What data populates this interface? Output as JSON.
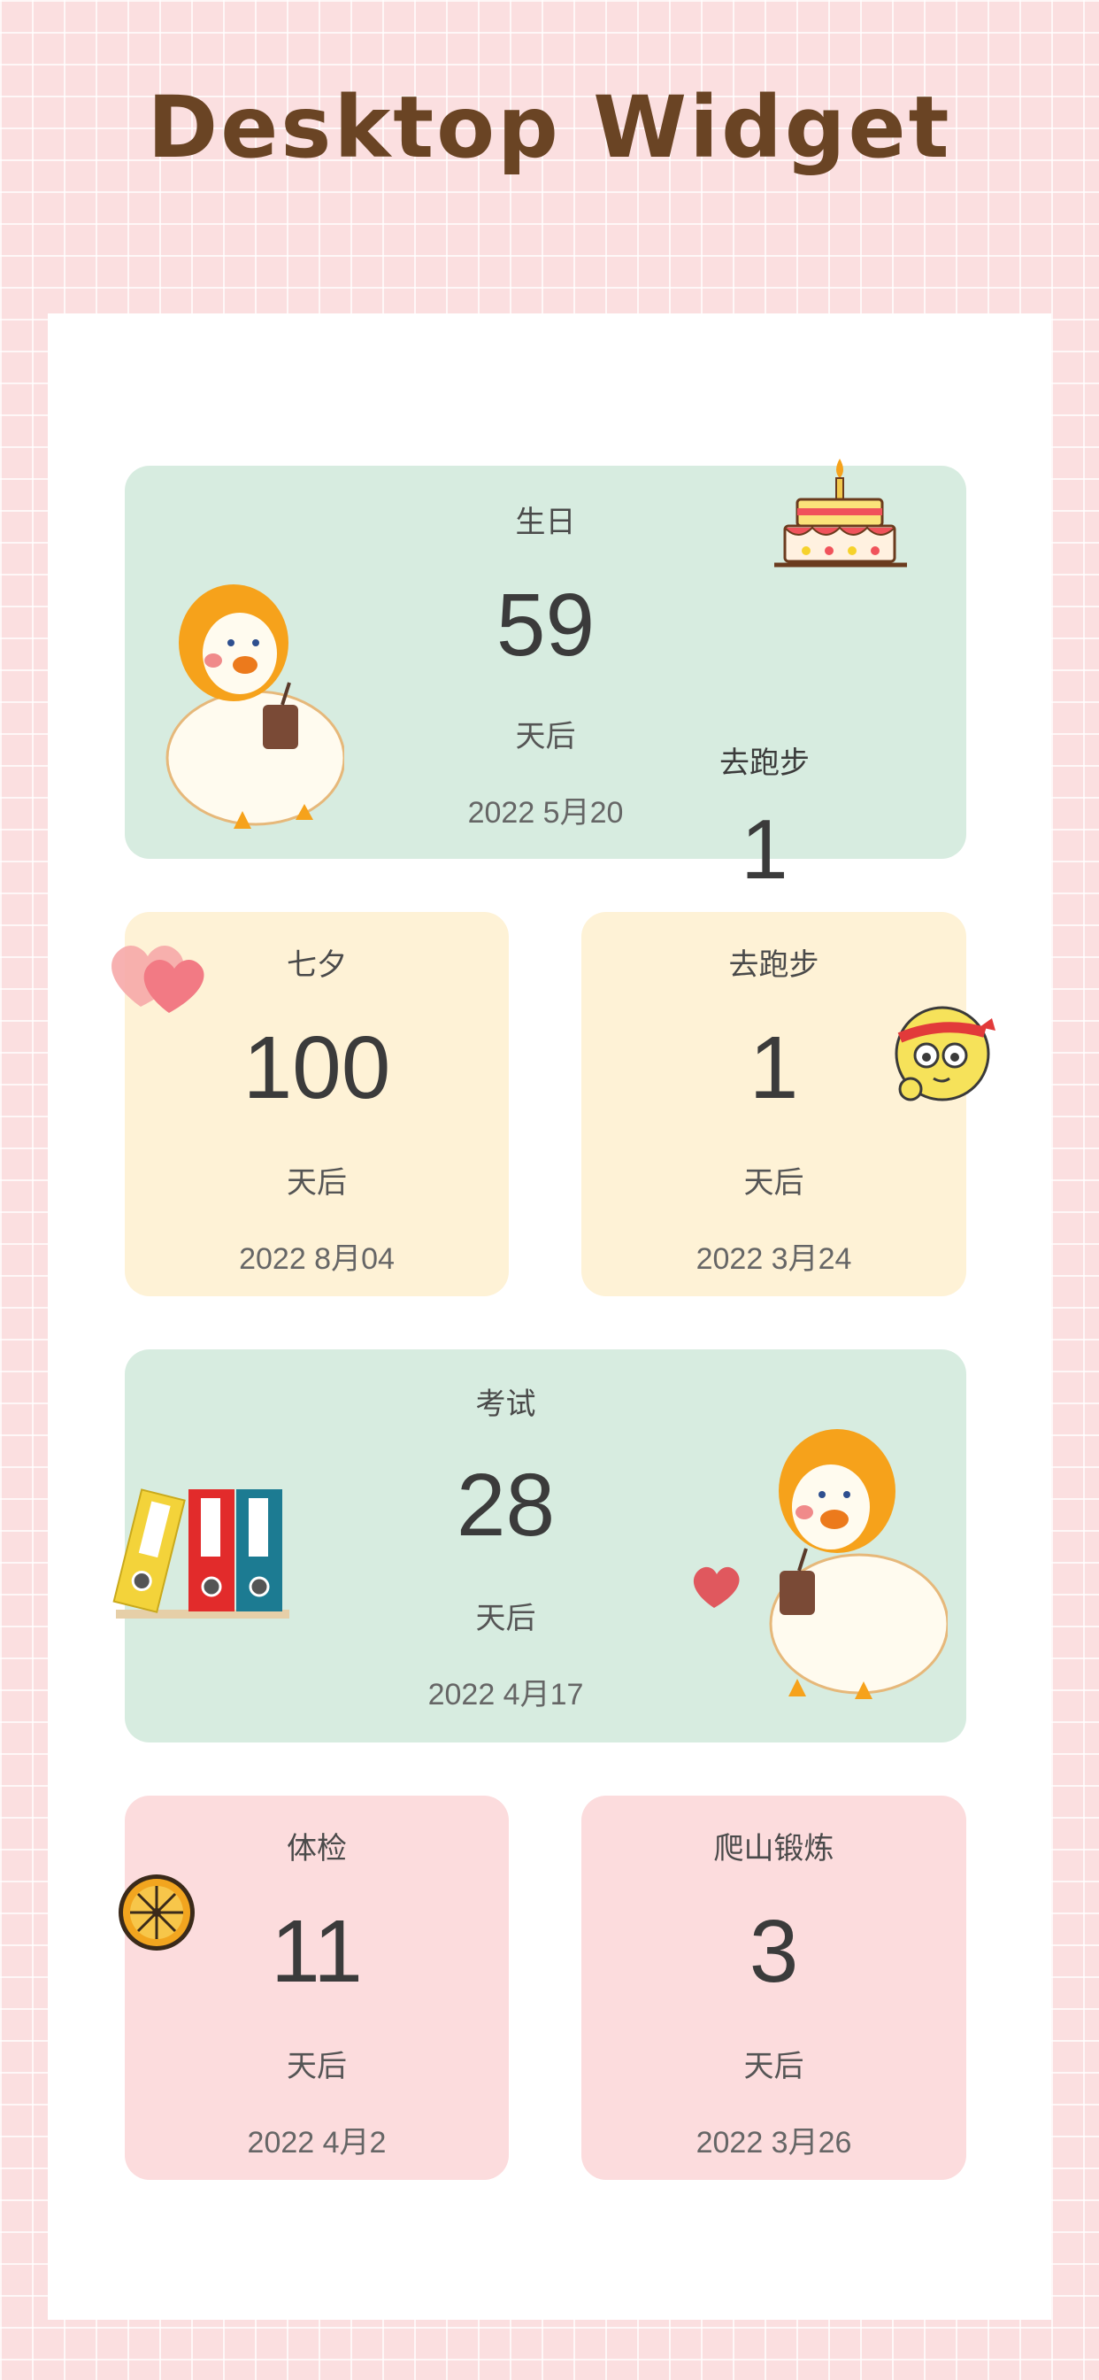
{
  "page_title": "Desktop Widget",
  "cards": [
    {
      "title": "生日",
      "days": "59",
      "unit": "天后",
      "date": "2022 5月20"
    },
    {
      "title": "七夕",
      "days": "100",
      "unit": "天后",
      "date": "2022 8月04"
    },
    {
      "title": "去跑步",
      "days": "1",
      "unit": "天后",
      "date": "2022 3月24"
    },
    {
      "title": "考试",
      "days": "28",
      "unit": "天后",
      "date": "2022 4月17"
    },
    {
      "title": "体检",
      "days": "11",
      "unit": "天后",
      "date": "2022 4月2"
    },
    {
      "title": "爬山锻炼",
      "days": "3",
      "unit": "天后",
      "date": "2022 3月26"
    }
  ],
  "overlay": {
    "title": "去跑步",
    "days": "1"
  },
  "colors": {
    "background": "#fbdfe0",
    "title": "#6a4424",
    "card_green": "#d7ece0",
    "card_yellow": "#fef2d6",
    "card_pink": "#fcdcdd"
  },
  "decorations": [
    "duck-icon",
    "cake-icon",
    "hearts-icon",
    "emoji-face-icon",
    "binders-icon",
    "heart-icon",
    "orange-slice-icon"
  ]
}
